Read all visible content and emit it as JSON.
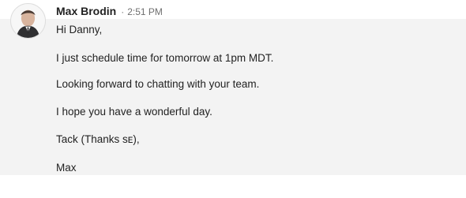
{
  "message": {
    "sender_name": "Max Brodin",
    "separator": "·",
    "timestamp": "2:51 PM",
    "avatar_alt": "sender-avatar",
    "lines": [
      "Hi Danny,",
      "I just schedule time for tomorrow at 1pm MDT.",
      "Looking forward to chatting with your team.",
      "I hope you have a wonderful day.",
      "Tack (Thanks sᴇ),",
      "Max"
    ],
    "colors": {
      "message_background": "#f3f3f3",
      "text": "#222222",
      "meta_text": "#6f6f6f"
    }
  }
}
